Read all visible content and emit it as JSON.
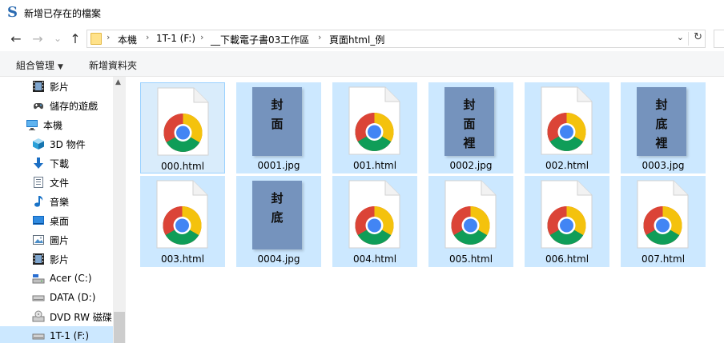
{
  "window": {
    "title": "新增已存在的檔案",
    "app_icon_glyph": "S"
  },
  "nav": {
    "back": "←",
    "forward": "→",
    "recent": "⌄",
    "up": "↑"
  },
  "address": {
    "crumbs": [
      "本機",
      "1T-1 (F:)",
      "__下載電子書03工作區",
      "頁面html_例"
    ],
    "separator": "›",
    "dropdown": "⌄",
    "refresh": "↻"
  },
  "commands": {
    "organize": "組合管理",
    "organize_caret": "▼",
    "new_folder": "新增資料夾"
  },
  "sidebar": {
    "scroll_up": "▲",
    "items": [
      {
        "label": "影片",
        "icon": "video-icon"
      },
      {
        "label": "儲存的遊戲",
        "icon": "saved-games-icon"
      },
      {
        "label": "本機",
        "icon": "this-pc-icon"
      },
      {
        "label": "3D 物件",
        "icon": "3d-objects-icon"
      },
      {
        "label": "下載",
        "icon": "downloads-icon"
      },
      {
        "label": "文件",
        "icon": "documents-icon"
      },
      {
        "label": "音樂",
        "icon": "music-icon"
      },
      {
        "label": "桌面",
        "icon": "desktop-icon"
      },
      {
        "label": "圖片",
        "icon": "pictures-icon"
      },
      {
        "label": "影片",
        "icon": "video-icon"
      },
      {
        "label": "Acer (C:)",
        "icon": "drive-c-icon"
      },
      {
        "label": "DATA (D:)",
        "icon": "drive-icon"
      },
      {
        "label": "DVD RW 磁碟",
        "icon": "dvd-drive-icon"
      },
      {
        "label": "1T-1 (F:)",
        "icon": "drive-icon"
      }
    ]
  },
  "files": [
    {
      "name": "000.html",
      "type": "html"
    },
    {
      "name": "0001.jpg",
      "type": "jpg",
      "caption": [
        "封",
        "面"
      ]
    },
    {
      "name": "001.html",
      "type": "html"
    },
    {
      "name": "0002.jpg",
      "type": "jpg",
      "caption": [
        "封",
        "面",
        "裡"
      ]
    },
    {
      "name": "002.html",
      "type": "html"
    },
    {
      "name": "0003.jpg",
      "type": "jpg",
      "caption": [
        "封",
        "底",
        "裡"
      ]
    },
    {
      "name": "003.html",
      "type": "html"
    },
    {
      "name": "0004.jpg",
      "type": "jpg",
      "caption": [
        "封",
        "底"
      ]
    },
    {
      "name": "004.html",
      "type": "html"
    },
    {
      "name": "005.html",
      "type": "html"
    },
    {
      "name": "006.html",
      "type": "html"
    },
    {
      "name": "007.html",
      "type": "html"
    }
  ],
  "colors": {
    "selection": "#cce8ff",
    "focus_border": "#99d1ff",
    "jpg_placeholder": "#7593bd",
    "chrome_red": "#db4437",
    "chrome_yellow": "#f4c20d",
    "chrome_green": "#0f9d58",
    "chrome_blue": "#4285f4"
  }
}
